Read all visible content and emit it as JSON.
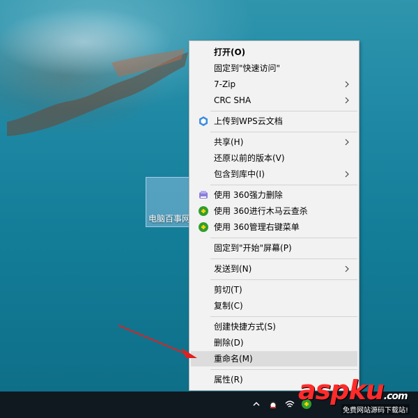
{
  "desktop": {
    "icon_label": "电脑百事网"
  },
  "menu": {
    "items": [
      {
        "label": "打开(O)",
        "bold": true
      },
      {
        "label": "固定到\"快速访问\""
      },
      {
        "label": "7-Zip",
        "submenu": true
      },
      {
        "label": "CRC SHA",
        "submenu": true
      },
      {
        "label": "上传到WPS云文档",
        "icon": "wps-cloud-icon"
      },
      {
        "label": "共享(H)",
        "submenu": true
      },
      {
        "label": "还原以前的版本(V)"
      },
      {
        "label": "包含到库中(I)",
        "submenu": true
      },
      {
        "label": "使用 360强力删除",
        "icon": "360-delete-icon"
      },
      {
        "label": "使用 360进行木马云查杀",
        "icon": "360-scan-icon"
      },
      {
        "label": "使用 360管理右键菜单",
        "icon": "360-manage-icon"
      },
      {
        "label": "固定到\"开始\"屏幕(P)"
      },
      {
        "label": "发送到(N)",
        "submenu": true
      },
      {
        "label": "剪切(T)"
      },
      {
        "label": "复制(C)"
      },
      {
        "label": "创建快捷方式(S)"
      },
      {
        "label": "删除(D)"
      },
      {
        "label": "重命名(M)",
        "highlighted": true
      },
      {
        "label": "属性(R)"
      }
    ]
  },
  "watermark": {
    "brand": "aspku",
    "domain": ".com",
    "subtitle": "免费网站源码下载站!"
  },
  "colors": {
    "menu_bg": "#f2f2f2",
    "highlight": "#dcdcdc",
    "arrow": "#e02020",
    "taskbar": "#101820"
  }
}
